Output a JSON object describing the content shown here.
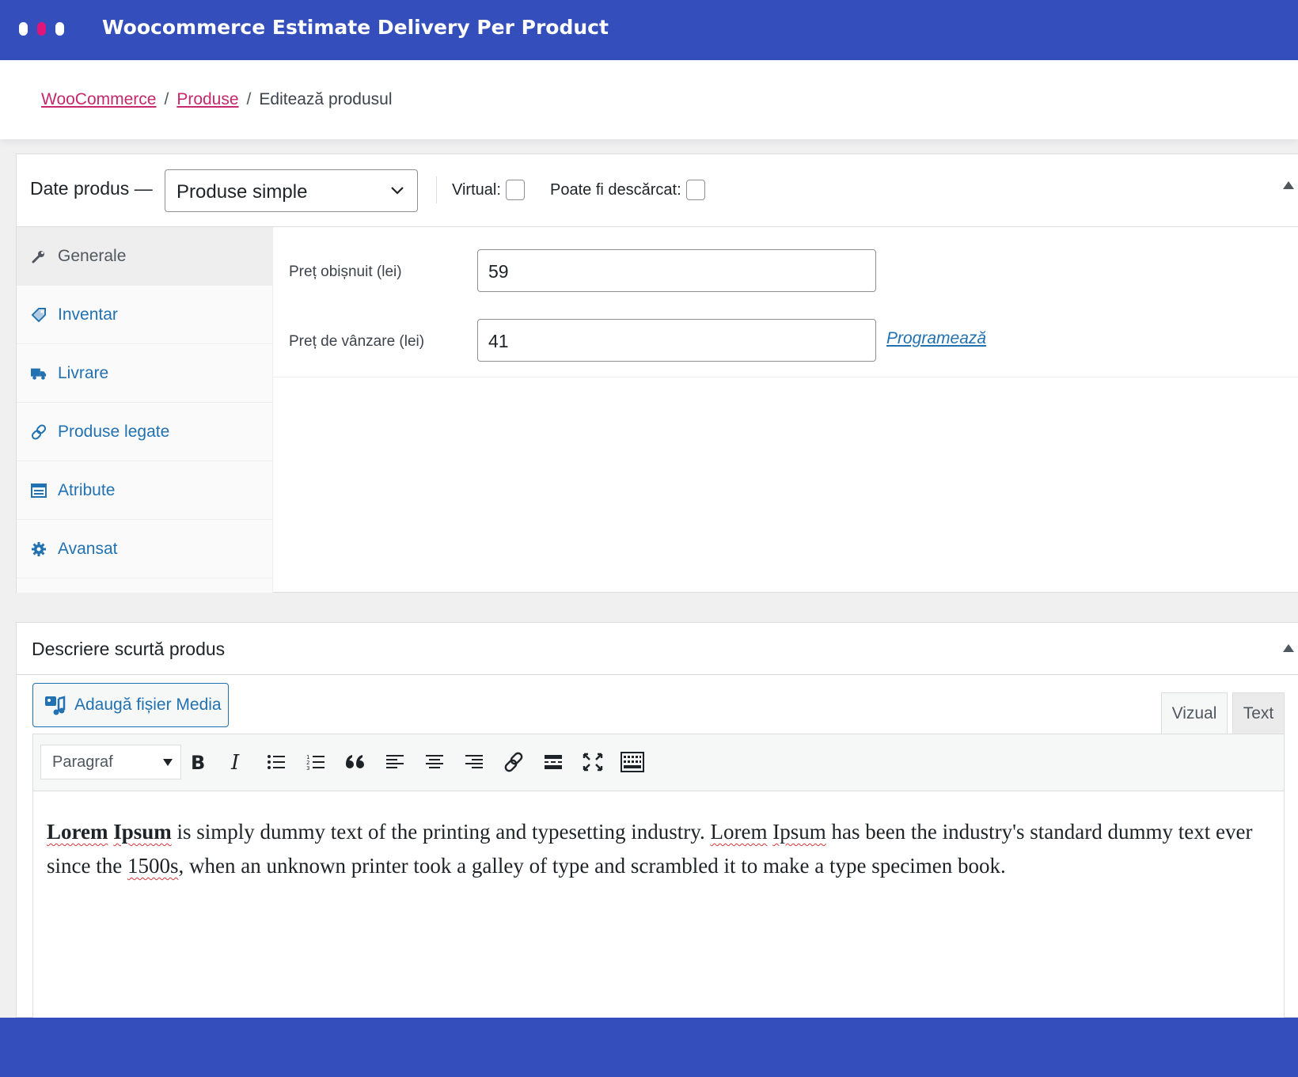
{
  "window": {
    "title": "Woocommerce Estimate Delivery Per Product"
  },
  "breadcrumb": {
    "items": [
      "WooCommerce",
      "Produse"
    ],
    "separator": "/",
    "current": "Editează produsul"
  },
  "product_data": {
    "label": "Date produs —",
    "type_select": "Produse simple",
    "virtual_label": "Virtual:",
    "virtual_checked": false,
    "downloadable_label": "Poate fi descărcat:",
    "downloadable_checked": false,
    "tabs": [
      {
        "label": "Generale",
        "icon": "wrench-icon",
        "active": true
      },
      {
        "label": "Inventar",
        "icon": "tag-icon",
        "active": false
      },
      {
        "label": "Livrare",
        "icon": "truck-icon",
        "active": false
      },
      {
        "label": "Produse legate",
        "icon": "link-icon",
        "active": false
      },
      {
        "label": "Atribute",
        "icon": "list-icon",
        "active": false
      },
      {
        "label": "Avansat",
        "icon": "gear-icon",
        "active": false
      }
    ],
    "regular_price_label": "Preț obișnuit (lei)",
    "regular_price": "59",
    "sale_price_label": "Preț de vânzare (lei)",
    "sale_price": "41",
    "schedule_link": "Programează"
  },
  "short_description": {
    "title": "Descriere scurtă produs",
    "add_media": "Adaugă fișier Media",
    "mode_visual": "Vizual",
    "mode_text": "Text",
    "format_select": "Paragraf",
    "toolbar_icons": [
      "bold-icon",
      "italic-icon",
      "bullet-list-icon",
      "numbered-list-icon",
      "blockquote-icon",
      "align-left-icon",
      "align-center-icon",
      "align-right-icon",
      "link-icon",
      "read-more-icon",
      "fullscreen-icon",
      "toolbar-toggle-icon"
    ],
    "content": {
      "w1": "Lorem",
      "w2": "Ipsum",
      "t1": " is simply dummy text of the printing and typesetting industry. ",
      "w3": "Lorem",
      "w4": "Ipsum",
      "t2": " has been the industry's standard dummy text ever since the ",
      "w5": "1500s",
      "t3": ", when an unknown printer took a galley of type and scrambled it to make a type specimen book."
    }
  },
  "colors": {
    "brand_bar": "#344fbb",
    "accent_pink": "#c6286c",
    "link_blue": "#2271b1"
  }
}
